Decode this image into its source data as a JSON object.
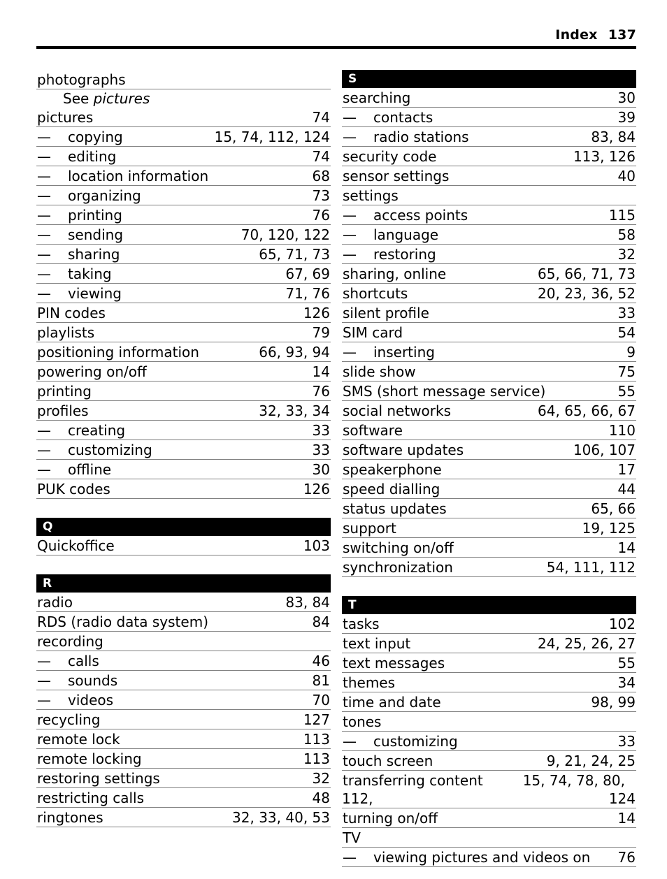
{
  "header": {
    "title": "Index",
    "page_number": "137"
  },
  "columns": [
    {
      "name": "left-column",
      "blocks": [
        {
          "type": "entries",
          "entries": [
            {
              "term": "photographs",
              "pages": "",
              "sub": false
            },
            {
              "term": "See pictures",
              "see": "See",
              "see_target": "pictures",
              "crossref": true
            },
            {
              "term": "pictures",
              "pages": "74",
              "sub": false
            },
            {
              "term": "copying",
              "pages": "15, 74, 112, 124",
              "sub": true
            },
            {
              "term": "editing",
              "pages": "74",
              "sub": true
            },
            {
              "term": "location information",
              "pages": "68",
              "sub": true
            },
            {
              "term": "organizing",
              "pages": "73",
              "sub": true
            },
            {
              "term": "printing",
              "pages": "76",
              "sub": true
            },
            {
              "term": "sending",
              "pages": "70, 120, 122",
              "sub": true
            },
            {
              "term": "sharing",
              "pages": "65, 71, 73",
              "sub": true
            },
            {
              "term": "taking",
              "pages": "67, 69",
              "sub": true
            },
            {
              "term": "viewing",
              "pages": "71, 76",
              "sub": true
            },
            {
              "term": "PIN codes",
              "pages": "126",
              "sub": false
            },
            {
              "term": "playlists",
              "pages": "79",
              "sub": false
            },
            {
              "term": "positioning information",
              "pages": "66, 93, 94",
              "sub": false
            },
            {
              "term": "powering on/off",
              "pages": "14",
              "sub": false
            },
            {
              "term": "printing",
              "pages": "76",
              "sub": false
            },
            {
              "term": "profiles",
              "pages": "32, 33, 34",
              "sub": false
            },
            {
              "term": "creating",
              "pages": "33",
              "sub": true
            },
            {
              "term": "customizing",
              "pages": "33",
              "sub": true
            },
            {
              "term": "offline",
              "pages": "30",
              "sub": true
            },
            {
              "term": "PUK codes",
              "pages": "126",
              "sub": false
            }
          ]
        },
        {
          "type": "gap"
        },
        {
          "type": "section",
          "letter": "Q"
        },
        {
          "type": "entries",
          "entries": [
            {
              "term": "Quickoffice",
              "pages": "103",
              "sub": false
            }
          ]
        },
        {
          "type": "gap"
        },
        {
          "type": "section",
          "letter": "R"
        },
        {
          "type": "entries",
          "entries": [
            {
              "term": "radio",
              "pages": "83, 84",
              "sub": false
            },
            {
              "term": "RDS (radio data system)",
              "pages": "84",
              "sub": false
            },
            {
              "term": "recording",
              "pages": "",
              "sub": false
            },
            {
              "term": "calls",
              "pages": "46",
              "sub": true
            },
            {
              "term": "sounds",
              "pages": "81",
              "sub": true
            },
            {
              "term": "videos",
              "pages": "70",
              "sub": true
            },
            {
              "term": "recycling",
              "pages": "127",
              "sub": false
            },
            {
              "term": "remote lock",
              "pages": "113",
              "sub": false
            },
            {
              "term": "remote locking",
              "pages": "113",
              "sub": false
            },
            {
              "term": "restoring settings",
              "pages": "32",
              "sub": false
            },
            {
              "term": "restricting calls",
              "pages": "48",
              "sub": false
            },
            {
              "term": "ringtones",
              "pages": "32, 33, 40, 53",
              "sub": false
            }
          ]
        }
      ]
    },
    {
      "name": "right-column",
      "blocks": [
        {
          "type": "section",
          "letter": "S"
        },
        {
          "type": "entries",
          "entries": [
            {
              "term": "searching",
              "pages": "30",
              "sub": false
            },
            {
              "term": "contacts",
              "pages": "39",
              "sub": true
            },
            {
              "term": "radio stations",
              "pages": "83, 84",
              "sub": true
            },
            {
              "term": "security code",
              "pages": "113, 126",
              "sub": false
            },
            {
              "term": "sensor settings",
              "pages": "40",
              "sub": false
            },
            {
              "term": "settings",
              "pages": "",
              "sub": false
            },
            {
              "term": "access points",
              "pages": "115",
              "sub": true
            },
            {
              "term": "language",
              "pages": "58",
              "sub": true
            },
            {
              "term": "restoring",
              "pages": "32",
              "sub": true
            },
            {
              "term": "sharing, online",
              "pages": "65, 66, 71, 73",
              "sub": false
            },
            {
              "term": "shortcuts",
              "pages": "20, 23, 36, 52",
              "sub": false
            },
            {
              "term": "silent profile",
              "pages": "33",
              "sub": false
            },
            {
              "term": "SIM card",
              "pages": "54",
              "sub": false
            },
            {
              "term": "inserting",
              "pages": "9",
              "sub": true
            },
            {
              "term": "slide show",
              "pages": "75",
              "sub": false
            },
            {
              "term": "SMS (short message service)",
              "pages": "55",
              "sub": false
            },
            {
              "term": "social networks",
              "pages": "64, 65, 66, 67",
              "sub": false
            },
            {
              "term": "software",
              "pages": "110",
              "sub": false
            },
            {
              "term": "software updates",
              "pages": "106, 107",
              "sub": false
            },
            {
              "term": "speakerphone",
              "pages": "17",
              "sub": false
            },
            {
              "term": "speed dialling",
              "pages": "44",
              "sub": false
            },
            {
              "term": "status updates",
              "pages": "65, 66",
              "sub": false
            },
            {
              "term": "support",
              "pages": "19, 125",
              "sub": false
            },
            {
              "term": "switching on/off",
              "pages": "14",
              "sub": false
            },
            {
              "term": "synchronization",
              "pages": "54, 111, 112",
              "sub": false
            }
          ]
        },
        {
          "type": "gap"
        },
        {
          "type": "section",
          "letter": "T"
        },
        {
          "type": "entries",
          "entries": [
            {
              "term": "tasks",
              "pages": "102",
              "sub": false
            },
            {
              "term": "text input",
              "pages": "24, 25, 26, 27",
              "sub": false
            },
            {
              "term": "text messages",
              "pages": "55",
              "sub": false
            },
            {
              "term": "themes",
              "pages": "34",
              "sub": false
            },
            {
              "term": "time and date",
              "pages": "98, 99",
              "sub": false
            },
            {
              "term": "tones",
              "pages": "",
              "sub": false
            },
            {
              "term": "customizing",
              "pages": "33",
              "sub": true
            },
            {
              "term": "touch screen",
              "pages": "9, 21, 24, 25",
              "sub": false
            },
            {
              "term": "transferring content",
              "pages": "15, 74, 78, 80,",
              "pages_cont_left": "112,",
              "pages_cont_right": "124",
              "sub": false,
              "wrap": true
            },
            {
              "term": "turning on/off",
              "pages": "14",
              "sub": false
            },
            {
              "term": "TV",
              "pages": "",
              "sub": false
            },
            {
              "term": "viewing pictures and videos on",
              "pages": "76",
              "sub": true
            }
          ]
        }
      ]
    }
  ]
}
